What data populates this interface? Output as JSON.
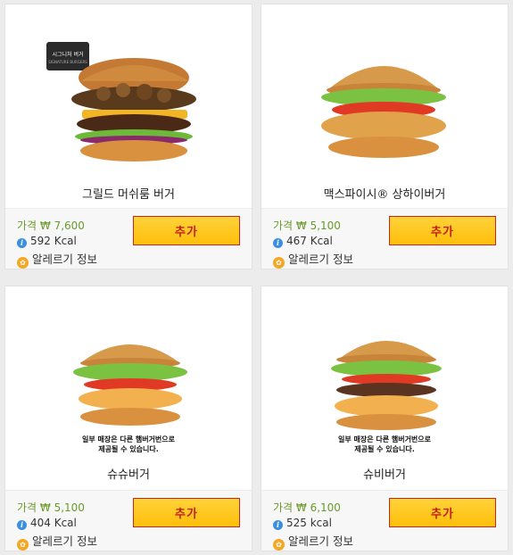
{
  "currency_label": "가격 ₩",
  "add_label": "추가",
  "allergy_label": "알레르기 정보",
  "badge": {
    "title": "시그니처 버거",
    "subtitle": "SIGNATURE BURGERS"
  },
  "colors": {
    "accent": "#ffc20e",
    "button_border": "#c8281e",
    "button_text": "#c41e16",
    "price_text": "#6a9a2a",
    "info_icon": "#3b8fe0",
    "allergy_icon": "#f5a623"
  },
  "products": [
    {
      "name": "그릴드 머쉬룸 버거",
      "price": "가격 ₩ 7,600",
      "kcal": "592 Kcal",
      "icon": "burger-mushroom"
    },
    {
      "name": "맥스파이시® 상하이버거",
      "price": "가격 ₩ 5,100",
      "kcal": "467 Kcal",
      "icon": "burger-chicken"
    },
    {
      "name": "슈슈버거",
      "price": "가격 ₩ 5,100",
      "kcal": "404 Kcal",
      "icon": "burger-shrimp",
      "notice_line1": "일부 매장은 다른 햄버거번으로",
      "notice_line2": "제공될 수 있습니다."
    },
    {
      "name": "슈비버거",
      "price": "가격 ₩ 6,100",
      "kcal": "525 kcal",
      "icon": "burger-shrimp-beef",
      "notice_line1": "일부 매장은 다른 햄버거번으로",
      "notice_line2": "제공될 수 있습니다."
    }
  ]
}
